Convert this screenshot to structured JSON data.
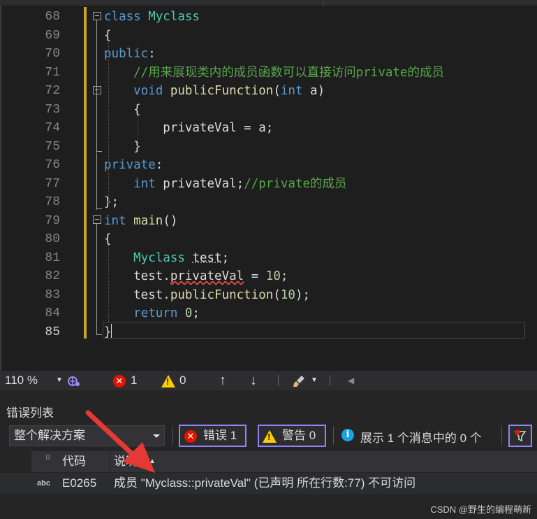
{
  "editor": {
    "lines": [
      {
        "num": "68",
        "tokens": [
          {
            "t": "class ",
            "c": "kw"
          },
          {
            "t": "Myclass",
            "c": "ty"
          }
        ]
      },
      {
        "num": "69",
        "tokens": [
          {
            "t": "{",
            "c": ""
          }
        ]
      },
      {
        "num": "70",
        "tokens": [
          {
            "t": "public",
            "c": "kw"
          },
          {
            "t": ":",
            "c": ""
          }
        ]
      },
      {
        "num": "71",
        "tokens": [
          {
            "t": "    //用来展现类内的成员函数可以直接访问private的成员",
            "c": "cm"
          }
        ]
      },
      {
        "num": "72",
        "tokens": [
          {
            "t": "    ",
            "c": ""
          },
          {
            "t": "void ",
            "c": "kw"
          },
          {
            "t": "publicFunction",
            "c": "fn"
          },
          {
            "t": "(",
            "c": ""
          },
          {
            "t": "int",
            "c": "kw"
          },
          {
            "t": " a)",
            "c": ""
          }
        ]
      },
      {
        "num": "73",
        "tokens": [
          {
            "t": "    {",
            "c": ""
          }
        ]
      },
      {
        "num": "74",
        "tokens": [
          {
            "t": "        privateVal = a;",
            "c": ""
          }
        ]
      },
      {
        "num": "75",
        "tokens": [
          {
            "t": "    }",
            "c": ""
          }
        ]
      },
      {
        "num": "76",
        "tokens": [
          {
            "t": "private",
            "c": "kw"
          },
          {
            "t": ":",
            "c": ""
          }
        ]
      },
      {
        "num": "77",
        "tokens": [
          {
            "t": "    ",
            "c": ""
          },
          {
            "t": "int",
            "c": "kw"
          },
          {
            "t": " privateVal;",
            "c": ""
          },
          {
            "t": "//private的成员",
            "c": "cm"
          }
        ]
      },
      {
        "num": "78",
        "tokens": [
          {
            "t": "};",
            "c": ""
          }
        ]
      },
      {
        "num": "79",
        "tokens": [
          {
            "t": "int ",
            "c": "kw"
          },
          {
            "t": "main",
            "c": "fn"
          },
          {
            "t": "()",
            "c": ""
          }
        ]
      },
      {
        "num": "80",
        "tokens": [
          {
            "t": "{",
            "c": ""
          }
        ]
      },
      {
        "num": "81",
        "tokens": [
          {
            "t": "    ",
            "c": ""
          },
          {
            "t": "Myclass",
            "c": "ty"
          },
          {
            "t": " ",
            "c": ""
          },
          {
            "t": "test",
            "c": "dots"
          },
          {
            "t": ";",
            "c": ""
          }
        ]
      },
      {
        "num": "82",
        "tokens": [
          {
            "t": "    test.",
            "c": ""
          },
          {
            "t": "privateVal",
            "c": "wavy"
          },
          {
            "t": " = ",
            "c": ""
          },
          {
            "t": "10",
            "c": "num"
          },
          {
            "t": ";",
            "c": ""
          }
        ]
      },
      {
        "num": "83",
        "tokens": [
          {
            "t": "    test.",
            "c": ""
          },
          {
            "t": "publicFunction",
            "c": "fn"
          },
          {
            "t": "(",
            "c": ""
          },
          {
            "t": "10",
            "c": "num"
          },
          {
            "t": ");",
            "c": ""
          }
        ]
      },
      {
        "num": "84",
        "tokens": [
          {
            "t": "    ",
            "c": ""
          },
          {
            "t": "return ",
            "c": "kw"
          },
          {
            "t": "0",
            "c": "num"
          },
          {
            "t": ";",
            "c": ""
          }
        ]
      },
      {
        "num": "85",
        "tokens": [
          {
            "t": "}",
            "c": ""
          }
        ]
      }
    ],
    "current_line": "85"
  },
  "status": {
    "zoom": "110 %",
    "errors": "1",
    "warnings": "0"
  },
  "panel": {
    "title": "错误列表",
    "scope": "整个解决方案",
    "errors_button": "错误 1",
    "warnings_button": "警告 0",
    "info_text": "展示 1 个消息中的 0 个",
    "col_code": "代码",
    "col_desc": "说明",
    "rows": [
      {
        "icon": "abc",
        "code": "E0265",
        "desc": "成员 \"Myclass::privateVal\" (已声明 所在行数:77) 不可访问"
      }
    ]
  },
  "watermark": "CSDN @野生的编程萌新",
  "colors": {
    "accent": "#8f84f4",
    "error": "#e51400",
    "warning": "#ffcc00",
    "arrow": "#e53935"
  }
}
